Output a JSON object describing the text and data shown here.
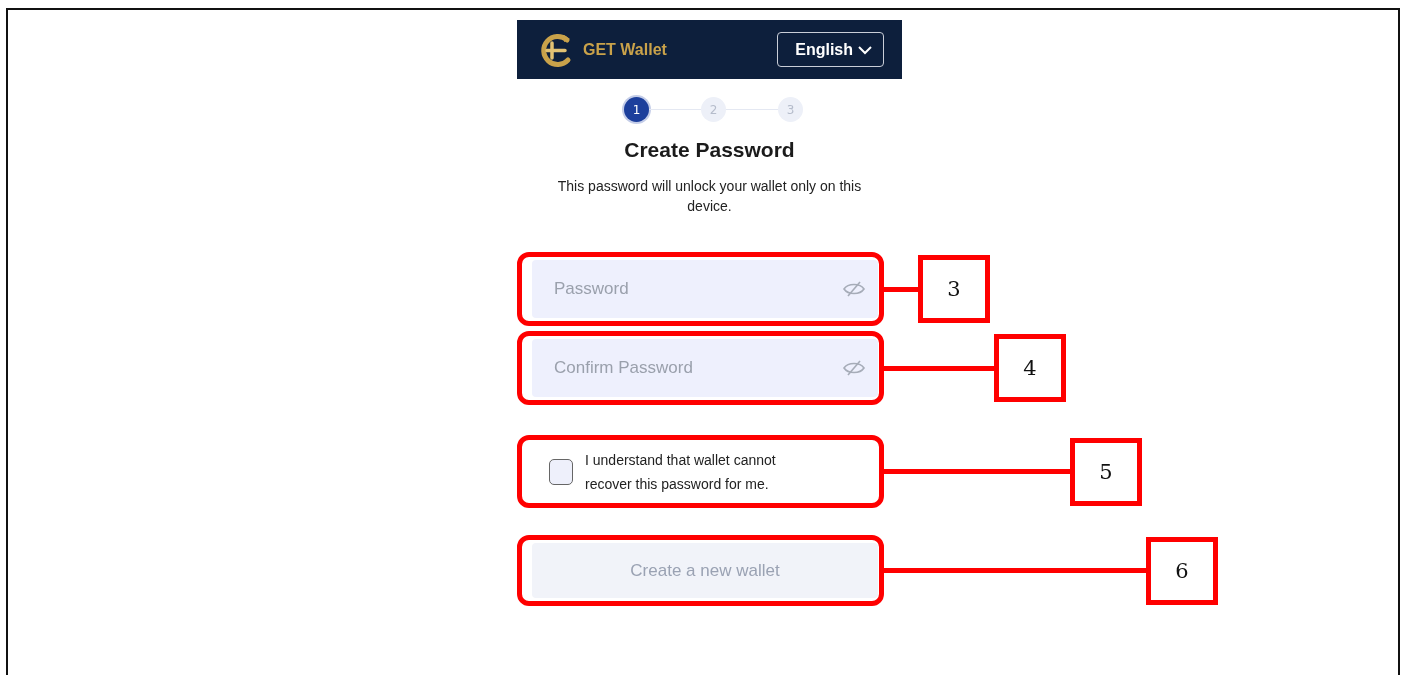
{
  "header": {
    "brand": "GET Wallet",
    "language": "English"
  },
  "steps": [
    {
      "label": "1",
      "selected": true
    },
    {
      "label": "2",
      "selected": false
    },
    {
      "label": "3",
      "selected": false
    }
  ],
  "title": "Create Password",
  "subtitle": "This password will unlock your wallet only on this device.",
  "fields": [
    {
      "placeholder": "Password",
      "callout": "3"
    },
    {
      "placeholder": "Confirm Password",
      "callout": "4"
    }
  ],
  "agreement": {
    "text": "I understand that wallet cannot recover this password for me.",
    "checked": false,
    "callout": "5"
  },
  "submit": {
    "label": "Create a new wallet",
    "disabled": true,
    "callout": "6"
  }
}
